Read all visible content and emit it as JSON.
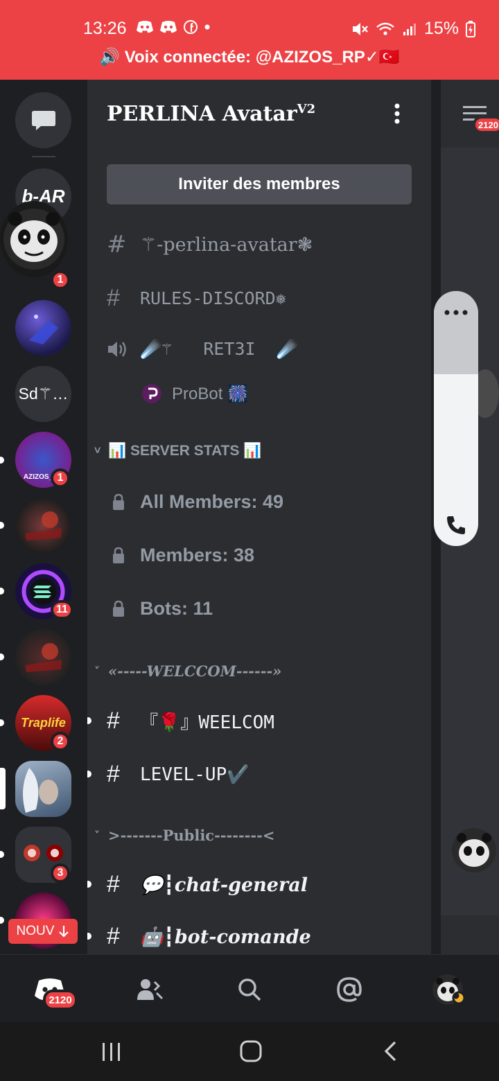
{
  "status_bar": {
    "time": "13:26",
    "battery": "15%",
    "voice_text": "Voix connectée: @AZIZOS_RP✓🇹🇷"
  },
  "guilds": [
    {
      "name": "dm-messages",
      "label": ""
    },
    {
      "name": "b-ar",
      "label": "b-AR"
    },
    {
      "name": "panda-avatar",
      "label": "",
      "badge": "1"
    },
    {
      "name": "purple-guild",
      "label": ""
    },
    {
      "name": "sd-guild",
      "label": "Sd⚚…"
    },
    {
      "name": "azizos-gang",
      "label": "AZIZOS_GA",
      "badge": "1"
    },
    {
      "name": "skull-guild-1",
      "label": ""
    },
    {
      "name": "solana-guild",
      "label": "",
      "badge": "11"
    },
    {
      "name": "skull-guild-2",
      "label": ""
    },
    {
      "name": "traplife-guild",
      "label": "Traplife",
      "badge": "2"
    },
    {
      "name": "white-hair-guild",
      "label": ""
    },
    {
      "name": "two-masks-guild",
      "label": "",
      "badge": "3"
    },
    {
      "name": "neon-guild",
      "label": ""
    }
  ],
  "new_pill": "NOUV",
  "server": {
    "name": "PERLINA Avatar",
    "name_sup": "V2",
    "invite_label": "Inviter des membres"
  },
  "channels_top": [
    {
      "type": "text",
      "name": "⚚-perlina-avatar❃"
    },
    {
      "type": "text",
      "name": "RULES-DISCORD❅"
    },
    {
      "type": "voice",
      "name": "☄️⚚   RET3I  ☄️"
    }
  ],
  "voice_member": "ProBot 🎆",
  "categories": [
    {
      "label": "📊 SERVER STATS 📊",
      "channels": [
        "All Members: 49",
        "Members: 38",
        "Bots: 11"
      ]
    },
    {
      "label": "«-----WELCCOM------»",
      "channels": [
        "『🌹』WEELCOM",
        "LEVEL-UP✔️"
      ]
    },
    {
      "label": ">-------Public--------<",
      "channels": [
        "💬┇chat-general",
        "🤖┇bot-comande"
      ]
    }
  ],
  "right_strip": {
    "badge": "2120"
  },
  "bottom_nav": {
    "home_badge": "2120"
  },
  "colors": {
    "accent_red": "#ed4245",
    "panel": "#2b2d31",
    "rail": "#1e1f22"
  }
}
